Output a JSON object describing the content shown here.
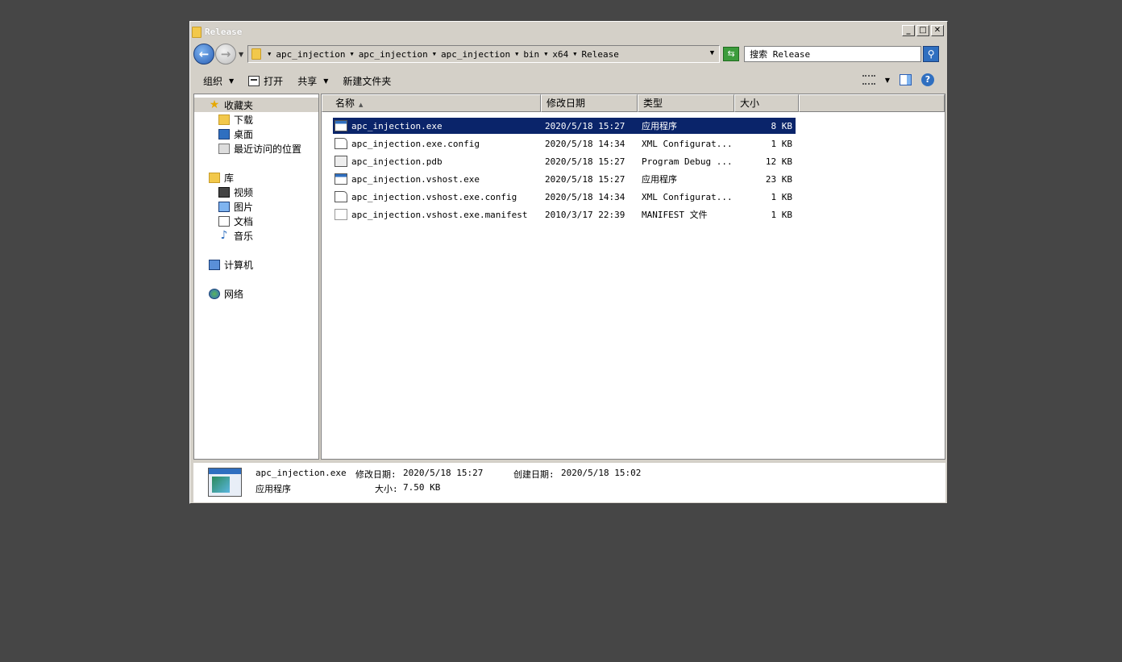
{
  "window": {
    "title": "Release",
    "buttons": {
      "minimize": "_",
      "maximize": "□",
      "close": "✕"
    }
  },
  "address": {
    "segments": [
      "apc_injection",
      "apc_injection",
      "apc_injection",
      "bin",
      "x64",
      "Release"
    ]
  },
  "search": {
    "placeholder": "搜索 Release"
  },
  "toolbar": {
    "organize": "组织",
    "open": "打开",
    "share": "共享",
    "new_folder": "新建文件夹"
  },
  "sidebar": {
    "favorites": "收藏夹",
    "downloads": "下载",
    "desktop": "桌面",
    "recent": "最近访问的位置",
    "libraries": "库",
    "videos": "视频",
    "pictures": "图片",
    "documents": "文档",
    "music": "音乐",
    "computer": "计算机",
    "network": "网络"
  },
  "columns": {
    "name": "名称",
    "date": "修改日期",
    "type": "类型",
    "size": "大小"
  },
  "files": [
    {
      "name": "apc_injection.exe",
      "date": "2020/5/18 15:27",
      "type": "应用程序",
      "size": "8 KB",
      "selected": true,
      "icon": "exe-icon"
    },
    {
      "name": "apc_injection.exe.config",
      "date": "2020/5/18 14:34",
      "type": "XML Configurat...",
      "size": "1 KB",
      "selected": false,
      "icon": "config-file-icon"
    },
    {
      "name": "apc_injection.pdb",
      "date": "2020/5/18 15:27",
      "type": "Program Debug ...",
      "size": "12 KB",
      "selected": false,
      "icon": "pdb-file-icon"
    },
    {
      "name": "apc_injection.vshost.exe",
      "date": "2020/5/18 15:27",
      "type": "应用程序",
      "size": "23 KB",
      "selected": false,
      "icon": "exe-icon"
    },
    {
      "name": "apc_injection.vshost.exe.config",
      "date": "2020/5/18 14:34",
      "type": "XML Configurat...",
      "size": "1 KB",
      "selected": false,
      "icon": "config-file-icon"
    },
    {
      "name": "apc_injection.vshost.exe.manifest",
      "date": "2010/3/17 22:39",
      "type": "MANIFEST 文件",
      "size": "1 KB",
      "selected": false,
      "icon": "manifest-file-icon"
    }
  ],
  "details": {
    "filename": "apc_injection.exe",
    "modified_label": "修改日期:",
    "modified": "2020/5/18 15:27",
    "created_label": "创建日期:",
    "created": "2020/5/18 15:02",
    "type": "应用程序",
    "size_label": "大小:",
    "size": "7.50 KB"
  },
  "colors": {
    "selection": "#0a246a",
    "chrome": "#d4d0c8",
    "desktop": "#464646"
  }
}
